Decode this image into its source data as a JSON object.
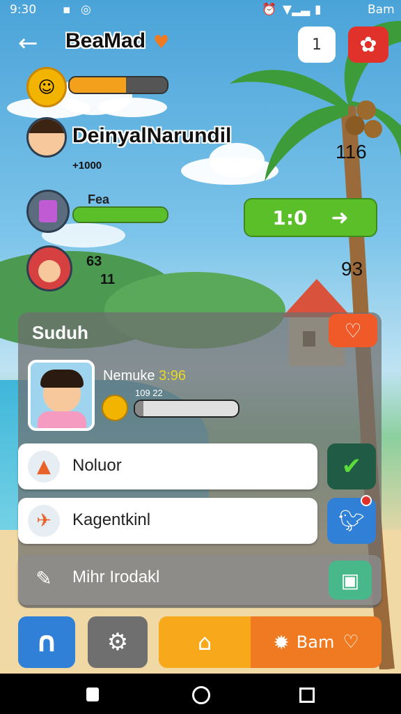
{
  "status_bar": {
    "time": "9:30",
    "right_text": "Bam"
  },
  "header": {
    "title": "BeaMad",
    "notebook_label": "1"
  },
  "players": [
    {
      "name": "DeinyalNarundil",
      "sub": "+1000",
      "score": "116"
    },
    {
      "tag": "Fea",
      "button_label": "1:0"
    },
    {
      "label_top": "63",
      "label_bottom": "11",
      "score": "93"
    }
  ],
  "panel": {
    "title": "Suduh",
    "profile": {
      "name": "Nemuke",
      "name_value": "3:96",
      "sub": "109 22"
    },
    "rows": [
      {
        "label": "Noluor"
      },
      {
        "label": "Kagentkinl"
      },
      {
        "label": "Mihr Irodakl"
      }
    ]
  },
  "bottom_bar": {
    "action_label": "Bam"
  },
  "colors": {
    "green": "#5bbf2a",
    "orange": "#f07a22",
    "gold": "#f2b400",
    "twitter": "#2f80d6"
  }
}
